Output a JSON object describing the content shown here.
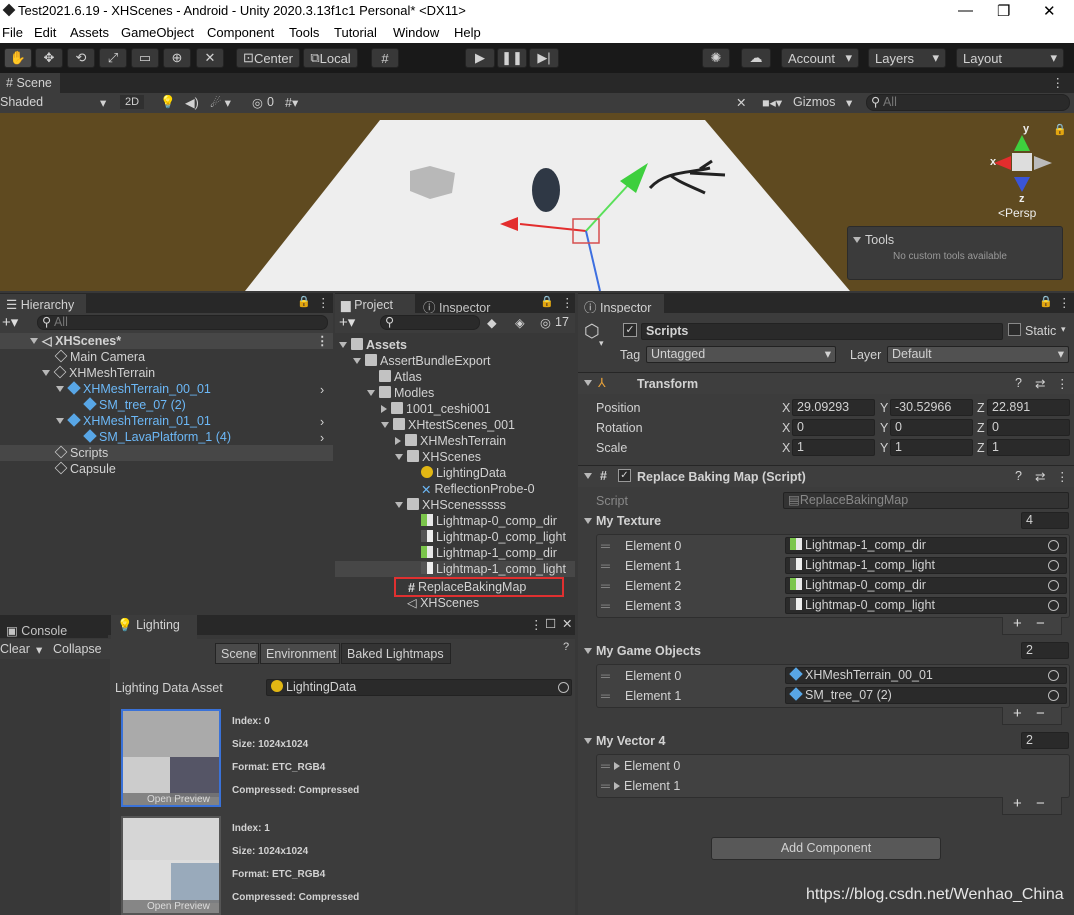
{
  "window": {
    "title": "Test2021.6.19 - XHScenes - Android - Unity 2020.3.13f1c1 Personal* <DX11>",
    "minimize": "—",
    "maximize": "❐",
    "close": "✕"
  },
  "menu": [
    "File",
    "Edit",
    "Assets",
    "GameObject",
    "Component",
    "Tools",
    "Tutorial",
    "Window",
    "Help"
  ],
  "toolbar": {
    "center": "Center",
    "local": "Local",
    "account": "Account",
    "layers": "Layers",
    "layout": "Layout"
  },
  "scene": {
    "tab": "Scene",
    "shading": "Shaded",
    "mode2d": "2D",
    "gizmos": "Gizmos",
    "search_placeholder": "All",
    "hidden_count": "0",
    "persp": "<Persp",
    "axis_x": "x",
    "axis_y": "y",
    "axis_z": "z",
    "tools_title": "Tools",
    "tools_body": "No custom tools available"
  },
  "hierarchy": {
    "tab": "Hierarchy",
    "search_placeholder": "All",
    "scene": "XHScenes*",
    "items": [
      "Main Camera",
      "XHMeshTerrain",
      "XHMeshTerrain_00_01",
      "SM_tree_07 (2)",
      "XHMeshTerrain_01_01",
      "SM_LavaPlatform_1 (4)",
      "Scripts",
      "Capsule"
    ]
  },
  "project": {
    "tab": "Project",
    "tab2": "Inspector",
    "hidden_count": "17",
    "items": [
      "Assets",
      "AssertBundleExport",
      "Atlas",
      "Modles",
      "1001_ceshi001",
      "XHtestScenes_001",
      "XHMeshTerrain",
      "XHScenes",
      "LightingData",
      "ReflectionProbe-0",
      "XHScenesssss",
      "Lightmap-0_comp_dir",
      "Lightmap-0_comp_light",
      "Lightmap-1_comp_dir",
      "Lightmap-1_comp_light",
      "ReplaceBakingMap",
      "XHScenes"
    ]
  },
  "console": {
    "tab": "Console",
    "clear": "Clear",
    "collapse": "Collapse"
  },
  "lighting": {
    "tab": "Lighting",
    "tabs": [
      "Scene",
      "Environment",
      "Baked Lightmaps"
    ],
    "asset_label": "Lighting Data Asset",
    "asset_value": "LightingData",
    "open_preview": "Open Preview",
    "maps": [
      {
        "index": "Index: 0",
        "size": "Size: 1024x1024",
        "format": "Format: ETC_RGB4",
        "compressed": "Compressed: Compressed"
      },
      {
        "index": "Index: 1",
        "size": "Size: 1024x1024",
        "format": "Format: ETC_RGB4",
        "compressed": "Compressed: Compressed"
      }
    ]
  },
  "inspector": {
    "tab": "Inspector",
    "name": "Scripts",
    "static": "Static",
    "tag_label": "Tag",
    "tag_value": "Untagged",
    "layer_label": "Layer",
    "layer_value": "Default",
    "transform": {
      "title": "Transform",
      "position": "Position",
      "rotation": "Rotation",
      "scale": "Scale",
      "px": "29.09293",
      "py": "-30.52966",
      "pz": "22.891",
      "rx": "0",
      "ry": "0",
      "rz": "0",
      "sx": "1",
      "sy": "1",
      "sz": "1",
      "x": "X",
      "y": "Y",
      "z": "Z"
    },
    "script": {
      "title": "Replace Baking Map (Script)",
      "script_label": "Script",
      "script_value": "ReplaceBakingMap",
      "texture_label": "My Texture",
      "texture_count": "4",
      "textures": [
        {
          "label": "Element 0",
          "value": "Lightmap-1_comp_dir"
        },
        {
          "label": "Element 1",
          "value": "Lightmap-1_comp_light"
        },
        {
          "label": "Element 2",
          "value": "Lightmap-0_comp_dir"
        },
        {
          "label": "Element 3",
          "value": "Lightmap-0_comp_light"
        }
      ],
      "go_label": "My Game Objects",
      "go_count": "2",
      "gos": [
        {
          "label": "Element 0",
          "value": "XHMeshTerrain_00_01"
        },
        {
          "label": "Element 1",
          "value": "SM_tree_07 (2)"
        }
      ],
      "vec_label": "My Vector 4",
      "vec_count": "2",
      "vecs": [
        "Element 0",
        "Element 1"
      ]
    },
    "add_component": "Add Component"
  },
  "watermark": "https://blog.csdn.net/Wenhao_China"
}
